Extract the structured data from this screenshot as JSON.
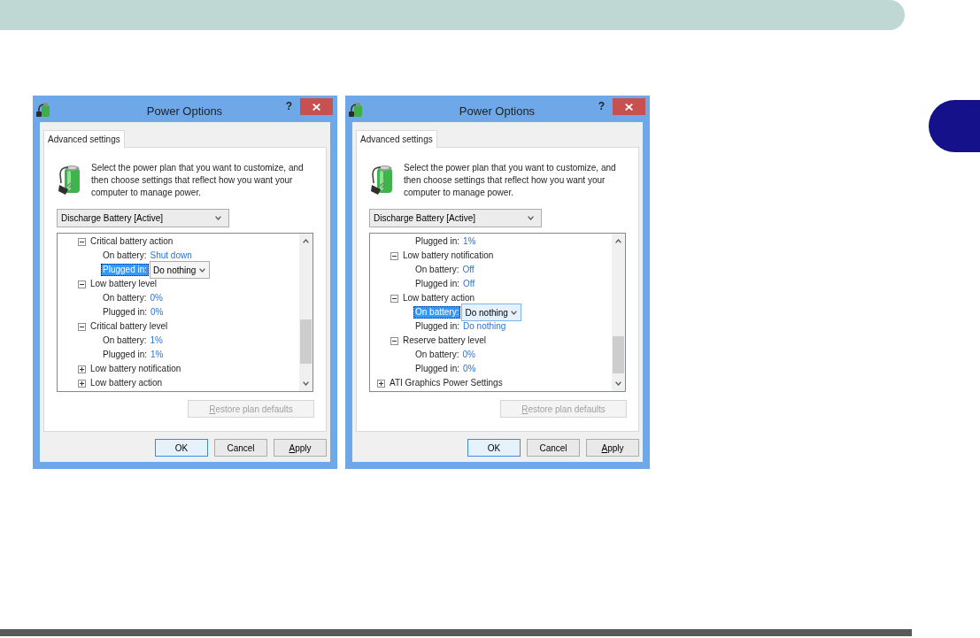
{
  "dialogs": [
    {
      "title": "Power Options",
      "help_button": "?",
      "tabs": [
        {
          "label": "Advanced settings",
          "selected": true
        }
      ],
      "description": "Select the power plan that you want to customize, and then choose settings that reflect how you want your computer to manage power.",
      "plan_dropdown": {
        "value": "Discharge Battery [Active]"
      },
      "tree": [
        {
          "kind": "group",
          "children": [
            {
              "kind": "group",
              "label": "Critical battery action",
              "expanded": true,
              "selected": false,
              "children": [
                {
                  "kind": "setting",
                  "label": "On battery:",
                  "value": "Shut down",
                  "selected": false
                },
                {
                  "kind": "setting",
                  "label": "Plugged in:",
                  "value": "Do nothing",
                  "selected": true,
                  "focused": false
                }
              ]
            },
            {
              "kind": "group",
              "label": "Low battery level",
              "expanded": true,
              "selected": false,
              "children": [
                {
                  "kind": "setting",
                  "label": "On battery:",
                  "value": "0%",
                  "selected": false
                },
                {
                  "kind": "setting",
                  "label": "Plugged in:",
                  "value": "0%",
                  "selected": false
                }
              ]
            },
            {
              "kind": "group",
              "label": "Critical battery level",
              "expanded": true,
              "selected": false,
              "children": [
                {
                  "kind": "setting",
                  "label": "On battery:",
                  "value": "1%",
                  "selected": false
                },
                {
                  "kind": "setting",
                  "label": "Plugged in:",
                  "value": "1%",
                  "selected": false
                }
              ]
            },
            {
              "kind": "group",
              "label": "Low battery notification",
              "expanded": false,
              "selected": false
            },
            {
              "kind": "group",
              "label": "Low battery action",
              "expanded": false,
              "selected": false
            }
          ]
        }
      ],
      "restore_button": {
        "label": "Restore plan defaults",
        "disabled": true,
        "mnemonic": true
      },
      "buttons": [
        {
          "label": "OK",
          "default": true,
          "mnemonic": false
        },
        {
          "label": "Cancel",
          "default": false,
          "mnemonic": false
        },
        {
          "label": "Apply",
          "default": false,
          "mnemonic": true
        }
      ]
    },
    {
      "title": "Power Options",
      "help_button": "?",
      "tabs": [
        {
          "label": "Advanced settings",
          "selected": true
        }
      ],
      "description": "Select the power plan that you want to customize, and then choose settings that reflect how you want your computer to manage power.",
      "plan_dropdown": {
        "value": "Discharge Battery [Active]"
      },
      "tree": [
        {
          "kind": "group",
          "children": [
            {
              "kind": "group",
              "children": [
                {
                  "kind": "setting",
                  "label": "Plugged in:",
                  "value": "1%",
                  "selected": false
                }
              ]
            },
            {
              "kind": "group",
              "label": "Low battery notification",
              "expanded": true,
              "selected": false,
              "children": [
                {
                  "kind": "setting",
                  "label": "On battery:",
                  "value": "Off",
                  "selected": false
                },
                {
                  "kind": "setting",
                  "label": "Plugged in:",
                  "value": "Off",
                  "selected": false
                }
              ]
            },
            {
              "kind": "group",
              "label": "Low battery action",
              "expanded": true,
              "selected": false,
              "children": [
                {
                  "kind": "setting",
                  "label": "On battery:",
                  "value": "Do nothing",
                  "selected": true,
                  "focused": true
                },
                {
                  "kind": "setting",
                  "label": "Plugged in:",
                  "value": "Do nothing",
                  "selected": false
                }
              ]
            },
            {
              "kind": "group",
              "label": "Reserve battery level",
              "expanded": true,
              "selected": false,
              "children": [
                {
                  "kind": "setting",
                  "label": "On battery:",
                  "value": "0%",
                  "selected": false
                },
                {
                  "kind": "setting",
                  "label": "Plugged in:",
                  "value": "0%",
                  "selected": false
                }
              ]
            }
          ]
        },
        {
          "kind": "group",
          "label": "ATI Graphics Power Settings",
          "expanded": false,
          "selected": false
        }
      ],
      "restore_button": {
        "label": "Restore plan defaults",
        "disabled": true,
        "mnemonic": true
      },
      "buttons": [
        {
          "label": "OK",
          "default": true,
          "mnemonic": false
        },
        {
          "label": "Cancel",
          "default": false,
          "mnemonic": false
        },
        {
          "label": "Apply",
          "default": false,
          "mnemonic": true
        }
      ]
    }
  ]
}
